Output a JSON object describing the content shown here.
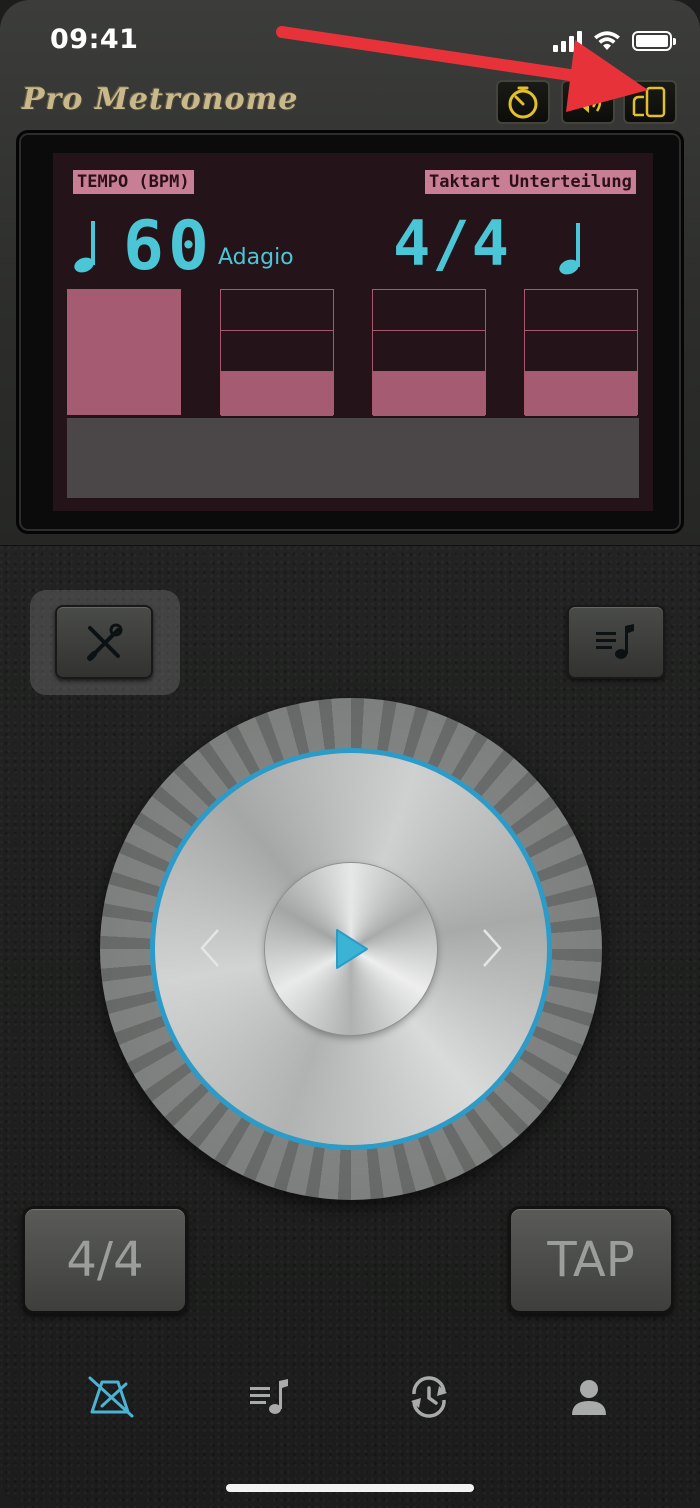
{
  "status_bar": {
    "time": "09:41"
  },
  "header": {
    "brand": "Pro Metronome"
  },
  "display": {
    "tempo_label": "TEMPO (BPM)",
    "meter_label": "Taktart",
    "subdivision_label": "Unterteilung",
    "tempo_value": "60",
    "tempo_name": "Adagio",
    "time_signature": "4/4",
    "accent_color": "#4bc6d6",
    "beat_color": "#a55c73"
  },
  "controls": {
    "time_signature_button": "4/4",
    "tap_button": "TAP"
  },
  "colors": {
    "dial_ring": "#2d9bc8",
    "arrow": "#e8323a",
    "top_icon": "#e2c02b"
  },
  "tabs": [
    {
      "icon": "metronome-icon",
      "active": true
    },
    {
      "icon": "playlist-icon",
      "active": false
    },
    {
      "icon": "history-icon",
      "active": false
    },
    {
      "icon": "profile-icon",
      "active": false
    }
  ]
}
